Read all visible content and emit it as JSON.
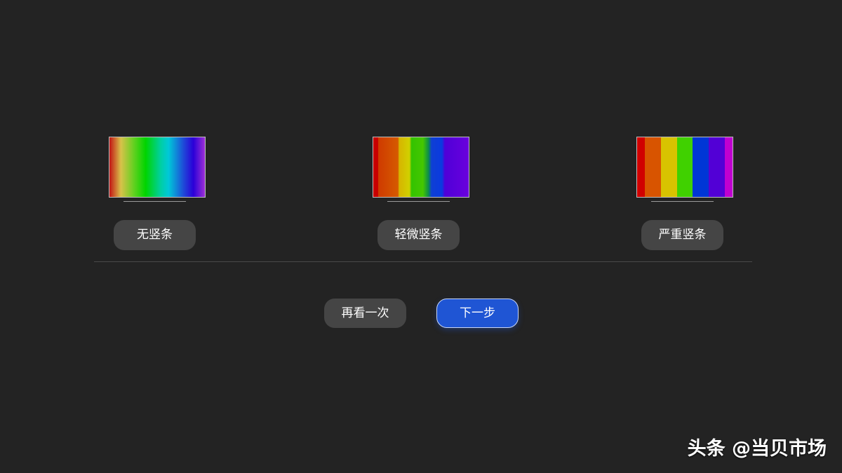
{
  "options": [
    {
      "label": "无竖条"
    },
    {
      "label": "轻微竖条"
    },
    {
      "label": "严重竖条"
    }
  ],
  "actions": {
    "replay_label": "再看一次",
    "next_label": "下一步"
  },
  "watermark": "头条 @当贝市场",
  "colors": {
    "background": "#232323",
    "button_gray": "#454545",
    "button_primary": "#1f55d4"
  }
}
